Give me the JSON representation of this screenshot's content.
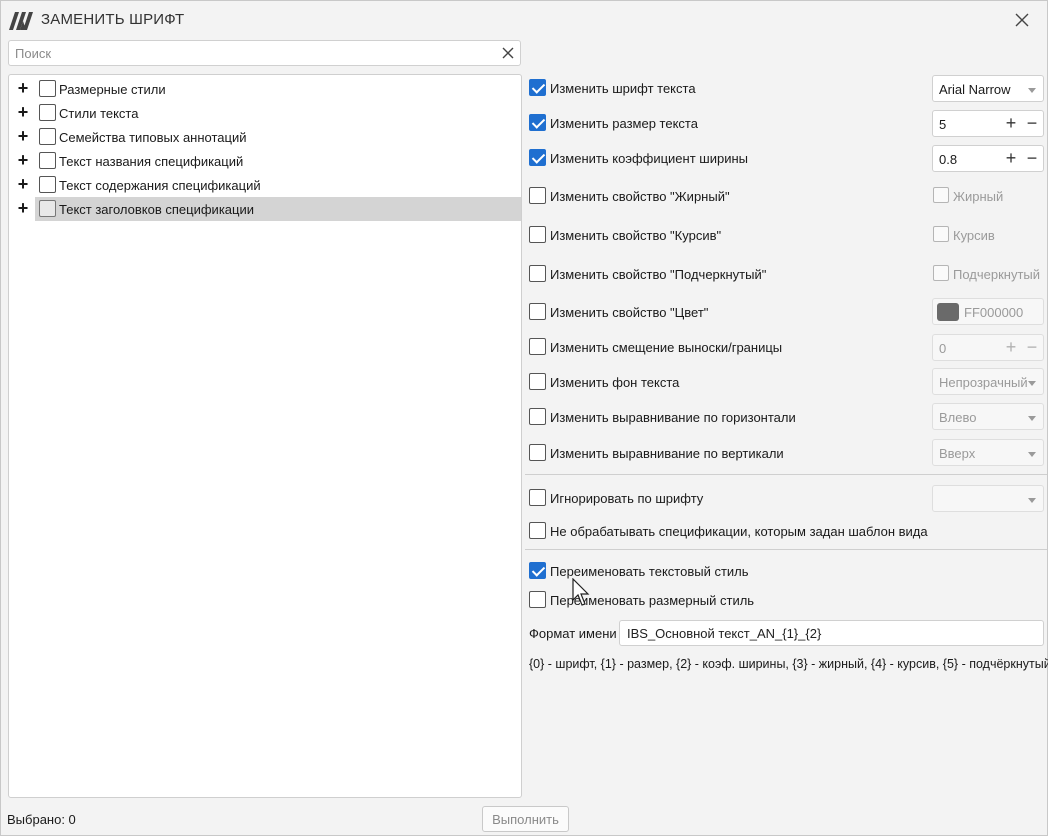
{
  "window": {
    "title": "ЗАМЕНИТЬ ШРИФТ",
    "accent": "#1f6fd0"
  },
  "search": {
    "placeholder": "Поиск",
    "value": ""
  },
  "tree": {
    "items": [
      {
        "label": "Размерные стили",
        "checked": false,
        "selected": false
      },
      {
        "label": "Стили текста",
        "checked": false,
        "selected": false
      },
      {
        "label": "Семейства типовых аннотаций",
        "checked": false,
        "selected": false
      },
      {
        "label": "Текст названия спецификаций",
        "checked": false,
        "selected": false
      },
      {
        "label": "Текст содержания спецификаций",
        "checked": false,
        "selected": false
      },
      {
        "label": "Текст заголовков спецификации",
        "checked": false,
        "selected": true
      }
    ]
  },
  "options": {
    "font": {
      "label": "Изменить шрифт текста",
      "checked": true,
      "value": "Arial Narrow"
    },
    "size": {
      "label": "Изменить размер текста",
      "checked": true,
      "value": "5"
    },
    "width": {
      "label": "Изменить коэффициент ширины",
      "checked": true,
      "value": "0.8"
    },
    "bold": {
      "label": "Изменить свойство \"Жирный\"",
      "checked": false,
      "ctrl_label": "Жирный"
    },
    "italic": {
      "label": "Изменить свойство \"Курсив\"",
      "checked": false,
      "ctrl_label": "Курсив"
    },
    "underline": {
      "label": "Изменить свойство \"Подчеркнутый\"",
      "checked": false,
      "ctrl_label": "Подчеркнутый"
    },
    "color": {
      "label": "Изменить свойство \"Цвет\"",
      "checked": false,
      "value": "FF000000",
      "swatch": "#6a6a6a"
    },
    "offset": {
      "label": "Изменить смещение выноски/границы",
      "checked": false,
      "value": "0"
    },
    "background": {
      "label": "Изменить фон текста",
      "checked": false,
      "value": "Непрозрачный"
    },
    "halign": {
      "label": "Изменить выравнивание по горизонтали",
      "checked": false,
      "value": "Влево"
    },
    "valign": {
      "label": "Изменить выравнивание по вертикали",
      "checked": false,
      "value": "Вверх"
    },
    "ignore_font": {
      "label": "Игнорировать по шрифту",
      "checked": false,
      "value": ""
    },
    "skip_specs": {
      "label": "Не обрабатывать спецификации, которым задан шаблон вида",
      "checked": false
    },
    "rename_text": {
      "label": "Переименовать текстовый стиль",
      "checked": true
    },
    "rename_dim": {
      "label": "Переименовать размерный стиль",
      "checked": false
    }
  },
  "format": {
    "label": "Формат имени",
    "value": "IBS_Основной текст_AN_{1}_{2}",
    "hint": "{0} - шрифт, {1} - размер, {2} - коэф. ширины, {3} - жирный, {4} - курсив, {5} - подчёркнутый"
  },
  "footer": {
    "status": "Выбрано: 0",
    "run_label": "Выполнить"
  },
  "icons": {
    "close": "close-icon",
    "clear": "clear-search-icon",
    "logo": "app-logo-icon",
    "expand": "expand-plus-icon",
    "cursor": "mouse-cursor-icon"
  }
}
